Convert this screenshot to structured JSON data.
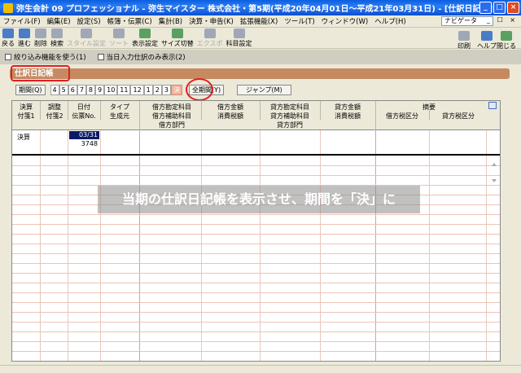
{
  "window": {
    "title": "弥生会計 09 プロフェッショナル - 弥生マイスター 株式会社・第5期(平成20年04月01日～平成21年03月31日) - [仕訳日記帳]",
    "min_label": "_",
    "max_label": "□",
    "close_label": "×"
  },
  "menu": {
    "items": [
      "ファイル(F)",
      "編集(E)",
      "設定(S)",
      "帳簿・伝票(C)",
      "集計(B)",
      "決算・申告(K)",
      "拡張機能(X)",
      "ツール(T)",
      "ウィンドウ(W)",
      "ヘルプ(H)"
    ],
    "navi": "ナビゲータ",
    "mdi": "_ ☐ ×"
  },
  "toolbar": {
    "buttons": [
      {
        "label": "戻る",
        "disabled": false
      },
      {
        "label": "進む",
        "disabled": false
      },
      {
        "label": "削除",
        "disabled": false
      },
      {
        "label": "検索",
        "disabled": false
      },
      {
        "label": "スタイル設定",
        "disabled": true
      },
      {
        "label": "ソート",
        "disabled": true
      },
      {
        "label": "表示設定",
        "disabled": false
      },
      {
        "label": "サイズ切替",
        "disabled": false
      },
      {
        "label": "エクスポ",
        "disabled": true
      },
      {
        "label": "科目設定",
        "disabled": false
      }
    ],
    "right_buttons": [
      {
        "label": "印刷"
      },
      {
        "label": "ヘルプ"
      },
      {
        "label": "閉じる"
      }
    ]
  },
  "options": {
    "narrow": "絞り込み機能を使う(1)",
    "today_only": "当日入力仕訳のみ表示(2)"
  },
  "header": {
    "title": "仕訳日記帳"
  },
  "period": {
    "label": "期間(Q)",
    "months": [
      "4",
      "5",
      "6",
      "7",
      "8",
      "9",
      "10",
      "11",
      "12",
      "1",
      "2",
      "3",
      "決"
    ],
    "selected": "決",
    "all_label": "全期間(Y)",
    "jump_label": "ジャンプ(M)"
  },
  "grid": {
    "columns": {
      "kessan": "決算",
      "chousei": "調整",
      "date": "日付",
      "type": "タイプ",
      "fusen1": "付箋1",
      "fusen2": "付箋2",
      "denpyo_no": "伝票No.",
      "seiseimoto": "生成元",
      "debit_account": "借方勘定科目",
      "debit_sub": "借方補助科目",
      "debit_dept": "借方部門",
      "debit_amount": "借方金額",
      "debit_tax": "消費税額",
      "credit_account": "貸方勘定科目",
      "credit_sub": "貸方補助科目",
      "credit_dept": "貸方部門",
      "credit_amount": "貸方金額",
      "credit_tax": "消費税額",
      "memo": "摘要",
      "debit_tax_class": "借方税区分",
      "credit_tax_class": "貸方税区分"
    },
    "row": {
      "kessan": "決算",
      "date": "03/31",
      "denpyo_no": "3748"
    }
  },
  "caption": "当期の仕訳日記帳を表示させ、期間を「決」に"
}
